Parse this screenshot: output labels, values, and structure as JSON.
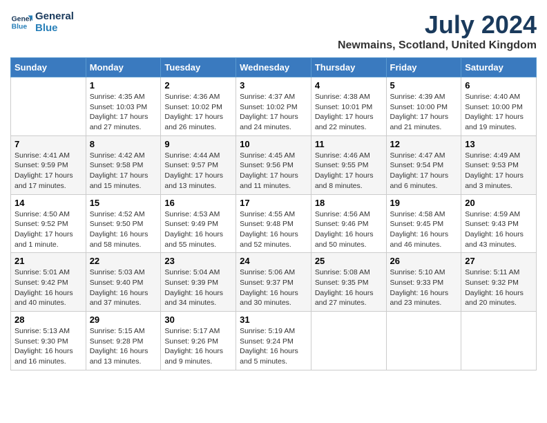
{
  "header": {
    "logo_general": "General",
    "logo_blue": "Blue",
    "month_title": "July 2024",
    "location": "Newmains, Scotland, United Kingdom"
  },
  "days_of_week": [
    "Sunday",
    "Monday",
    "Tuesday",
    "Wednesday",
    "Thursday",
    "Friday",
    "Saturday"
  ],
  "weeks": [
    [
      {
        "day": "",
        "info": ""
      },
      {
        "day": "1",
        "info": "Sunrise: 4:35 AM\nSunset: 10:03 PM\nDaylight: 17 hours and 27 minutes."
      },
      {
        "day": "2",
        "info": "Sunrise: 4:36 AM\nSunset: 10:02 PM\nDaylight: 17 hours and 26 minutes."
      },
      {
        "day": "3",
        "info": "Sunrise: 4:37 AM\nSunset: 10:02 PM\nDaylight: 17 hours and 24 minutes."
      },
      {
        "day": "4",
        "info": "Sunrise: 4:38 AM\nSunset: 10:01 PM\nDaylight: 17 hours and 22 minutes."
      },
      {
        "day": "5",
        "info": "Sunrise: 4:39 AM\nSunset: 10:00 PM\nDaylight: 17 hours and 21 minutes."
      },
      {
        "day": "6",
        "info": "Sunrise: 4:40 AM\nSunset: 10:00 PM\nDaylight: 17 hours and 19 minutes."
      }
    ],
    [
      {
        "day": "7",
        "info": "Sunrise: 4:41 AM\nSunset: 9:59 PM\nDaylight: 17 hours and 17 minutes."
      },
      {
        "day": "8",
        "info": "Sunrise: 4:42 AM\nSunset: 9:58 PM\nDaylight: 17 hours and 15 minutes."
      },
      {
        "day": "9",
        "info": "Sunrise: 4:44 AM\nSunset: 9:57 PM\nDaylight: 17 hours and 13 minutes."
      },
      {
        "day": "10",
        "info": "Sunrise: 4:45 AM\nSunset: 9:56 PM\nDaylight: 17 hours and 11 minutes."
      },
      {
        "day": "11",
        "info": "Sunrise: 4:46 AM\nSunset: 9:55 PM\nDaylight: 17 hours and 8 minutes."
      },
      {
        "day": "12",
        "info": "Sunrise: 4:47 AM\nSunset: 9:54 PM\nDaylight: 17 hours and 6 minutes."
      },
      {
        "day": "13",
        "info": "Sunrise: 4:49 AM\nSunset: 9:53 PM\nDaylight: 17 hours and 3 minutes."
      }
    ],
    [
      {
        "day": "14",
        "info": "Sunrise: 4:50 AM\nSunset: 9:52 PM\nDaylight: 17 hours and 1 minute."
      },
      {
        "day": "15",
        "info": "Sunrise: 4:52 AM\nSunset: 9:50 PM\nDaylight: 16 hours and 58 minutes."
      },
      {
        "day": "16",
        "info": "Sunrise: 4:53 AM\nSunset: 9:49 PM\nDaylight: 16 hours and 55 minutes."
      },
      {
        "day": "17",
        "info": "Sunrise: 4:55 AM\nSunset: 9:48 PM\nDaylight: 16 hours and 52 minutes."
      },
      {
        "day": "18",
        "info": "Sunrise: 4:56 AM\nSunset: 9:46 PM\nDaylight: 16 hours and 50 minutes."
      },
      {
        "day": "19",
        "info": "Sunrise: 4:58 AM\nSunset: 9:45 PM\nDaylight: 16 hours and 46 minutes."
      },
      {
        "day": "20",
        "info": "Sunrise: 4:59 AM\nSunset: 9:43 PM\nDaylight: 16 hours and 43 minutes."
      }
    ],
    [
      {
        "day": "21",
        "info": "Sunrise: 5:01 AM\nSunset: 9:42 PM\nDaylight: 16 hours and 40 minutes."
      },
      {
        "day": "22",
        "info": "Sunrise: 5:03 AM\nSunset: 9:40 PM\nDaylight: 16 hours and 37 minutes."
      },
      {
        "day": "23",
        "info": "Sunrise: 5:04 AM\nSunset: 9:39 PM\nDaylight: 16 hours and 34 minutes."
      },
      {
        "day": "24",
        "info": "Sunrise: 5:06 AM\nSunset: 9:37 PM\nDaylight: 16 hours and 30 minutes."
      },
      {
        "day": "25",
        "info": "Sunrise: 5:08 AM\nSunset: 9:35 PM\nDaylight: 16 hours and 27 minutes."
      },
      {
        "day": "26",
        "info": "Sunrise: 5:10 AM\nSunset: 9:33 PM\nDaylight: 16 hours and 23 minutes."
      },
      {
        "day": "27",
        "info": "Sunrise: 5:11 AM\nSunset: 9:32 PM\nDaylight: 16 hours and 20 minutes."
      }
    ],
    [
      {
        "day": "28",
        "info": "Sunrise: 5:13 AM\nSunset: 9:30 PM\nDaylight: 16 hours and 16 minutes."
      },
      {
        "day": "29",
        "info": "Sunrise: 5:15 AM\nSunset: 9:28 PM\nDaylight: 16 hours and 13 minutes."
      },
      {
        "day": "30",
        "info": "Sunrise: 5:17 AM\nSunset: 9:26 PM\nDaylight: 16 hours and 9 minutes."
      },
      {
        "day": "31",
        "info": "Sunrise: 5:19 AM\nSunset: 9:24 PM\nDaylight: 16 hours and 5 minutes."
      },
      {
        "day": "",
        "info": ""
      },
      {
        "day": "",
        "info": ""
      },
      {
        "day": "",
        "info": ""
      }
    ]
  ]
}
